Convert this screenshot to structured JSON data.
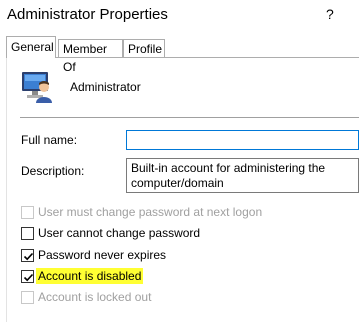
{
  "window": {
    "title": "Administrator Properties",
    "help": "?"
  },
  "tabs": [
    {
      "label": "General",
      "active": true
    },
    {
      "label": "Member Of",
      "active": false
    },
    {
      "label": "Profile",
      "active": false
    }
  ],
  "user": {
    "name": "Administrator",
    "icon": "user-computer-icon"
  },
  "fields": {
    "full_name": {
      "label": "Full name:",
      "value": ""
    },
    "description": {
      "label": "Description:",
      "value": "Built-in account for administering the\ncomputer/domain"
    }
  },
  "checkboxes": [
    {
      "label": "User must change password at next logon",
      "checked": false,
      "enabled": false
    },
    {
      "label": "User cannot change password",
      "checked": false,
      "enabled": true
    },
    {
      "label": "Password never expires",
      "checked": true,
      "enabled": true
    },
    {
      "label": "Account is disabled",
      "checked": true,
      "enabled": true,
      "highlight": "#ffff33"
    },
    {
      "label": "Account is locked out",
      "checked": false,
      "enabled": false
    }
  ],
  "colors": {
    "focus_border": "#0078d7",
    "highlight": "#ffff33",
    "disabled_text": "#a0a0a0"
  }
}
